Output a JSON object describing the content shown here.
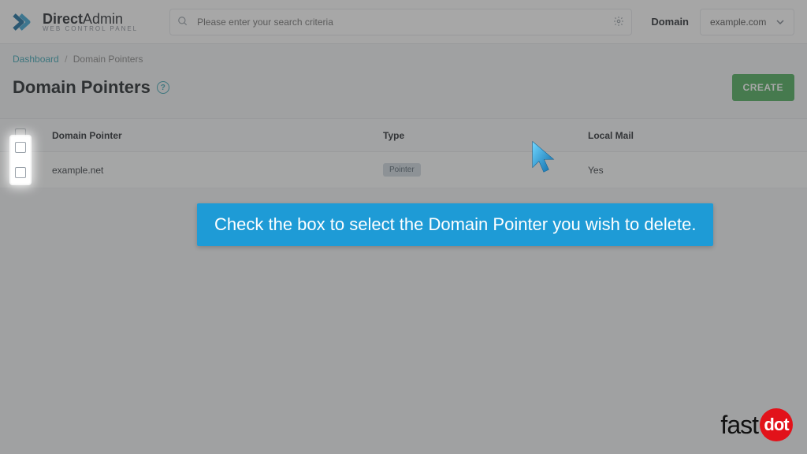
{
  "header": {
    "brand_primary": "Direct",
    "brand_secondary": "Admin",
    "brand_tagline": "web control panel",
    "search_placeholder": "Please enter your search criteria",
    "domain_label": "Domain",
    "domain_selected": "example.com"
  },
  "breadcrumb": {
    "root": "Dashboard",
    "current": "Domain Pointers"
  },
  "page": {
    "title": "Domain Pointers",
    "create_label": "CREATE"
  },
  "table": {
    "headers": {
      "pointer": "Domain Pointer",
      "type": "Type",
      "mail": "Local Mail"
    },
    "rows": [
      {
        "pointer": "example.net",
        "type_badge": "Pointer",
        "mail": "Yes"
      }
    ]
  },
  "tooltip": "Check the box to select the Domain Pointer you wish to delete.",
  "watermark": {
    "pre": "fast",
    "dot": "dot"
  }
}
